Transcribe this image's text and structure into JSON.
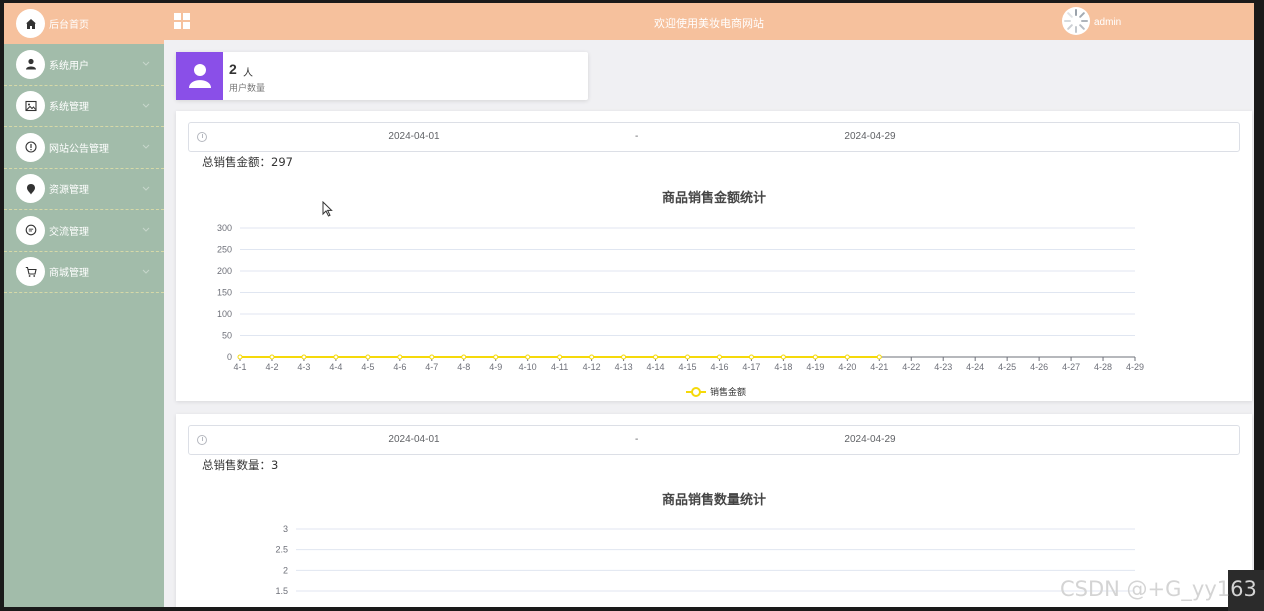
{
  "header": {
    "title": "欢迎使用美妆电商网站",
    "username": "admin"
  },
  "sidebar": {
    "items": [
      {
        "label": "后台首页",
        "icon": "home-icon",
        "active": true
      },
      {
        "label": "系统用户",
        "icon": "user-icon"
      },
      {
        "label": "系统管理",
        "icon": "image-icon"
      },
      {
        "label": "网站公告管理",
        "icon": "alert-icon"
      },
      {
        "label": "资源管理",
        "icon": "pin-icon"
      },
      {
        "label": "交流管理",
        "icon": "chat-icon"
      },
      {
        "label": "商城管理",
        "icon": "cart-icon"
      }
    ]
  },
  "stat_card": {
    "value": "2",
    "unit": "人",
    "label": "用户数量",
    "color": "#8a4fe8"
  },
  "sales_amount_panel": {
    "start_date": "2024-04-01",
    "separator": "-",
    "end_date": "2024-04-29",
    "total_text": "总销售金额：297"
  },
  "sales_count_panel": {
    "start_date": "2024-04-01",
    "separator": "-",
    "end_date": "2024-04-29",
    "total_text": "总销售数量：3"
  },
  "chart_data": [
    {
      "type": "line",
      "title": "商品销售金额统计",
      "categories": [
        "4-1",
        "4-2",
        "4-3",
        "4-4",
        "4-5",
        "4-6",
        "4-7",
        "4-8",
        "4-9",
        "4-10",
        "4-11",
        "4-12",
        "4-13",
        "4-14",
        "4-15",
        "4-16",
        "4-17",
        "4-18",
        "4-19",
        "4-20",
        "4-21",
        "4-22",
        "4-23",
        "4-24",
        "4-25",
        "4-26",
        "4-27",
        "4-28",
        "4-29"
      ],
      "series": [
        {
          "name": "销售金额",
          "color": "#f5d90a",
          "values": [
            0,
            0,
            0,
            0,
            0,
            0,
            0,
            0,
            0,
            0,
            0,
            0,
            0,
            0,
            0,
            0,
            0,
            0,
            0,
            0,
            0
          ]
        }
      ],
      "ylim": [
        0,
        300
      ],
      "yticks": [
        0,
        50,
        100,
        150,
        200,
        250,
        300
      ],
      "grid": true,
      "legend": "bottom-center"
    },
    {
      "type": "line",
      "title": "商品销售数量统计",
      "categories": [],
      "series": [],
      "ylim": [
        0,
        3
      ],
      "yticks": [
        1.5,
        2,
        2.5,
        3
      ],
      "grid": true,
      "legend": "bottom-center"
    }
  ],
  "watermark": "CSDN @+G_yy163"
}
